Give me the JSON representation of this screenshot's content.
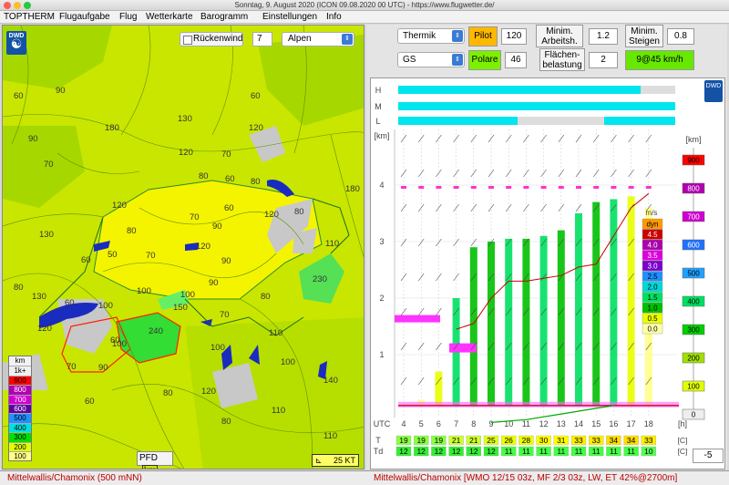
{
  "window": {
    "title": "Sonntag, 9. August 2020 (ICON 09.08.2020 00 UTC) - https://www.flugwetter.de/"
  },
  "menu": [
    "TOPTHERM",
    "Flugaufgabe",
    "Flug",
    "Wetterkarte",
    "Barogramm",
    "Einstellungen",
    "Info"
  ],
  "map": {
    "logo": "DWD",
    "rueckenwind_label": "Rückenwind",
    "stepper_value": "7",
    "region_value": "Alpen",
    "altitude_unit": "km",
    "legend": [
      "1k+",
      "900",
      "800",
      "700",
      "600",
      "500",
      "400",
      "300",
      "200",
      "100"
    ],
    "legend_colors": [
      "#f0f0f0",
      "#ff0000",
      "#b000b0",
      "#d000d0",
      "#6000a0",
      "#2090ff",
      "#00e0e0",
      "#00e000",
      "#e0ff00",
      "#ffff88"
    ],
    "pfd_label": "PFD",
    "pfd_unit": "km",
    "wind_label": "25 KT",
    "labels": [
      {
        "t": "60",
        "x": 12,
        "y": 80
      },
      {
        "t": "90",
        "x": 58,
        "y": 74
      },
      {
        "t": "90",
        "x": 28,
        "y": 127
      },
      {
        "t": "180",
        "x": 112,
        "y": 115
      },
      {
        "t": "70",
        "x": 45,
        "y": 155
      },
      {
        "t": "130",
        "x": 192,
        "y": 105
      },
      {
        "t": "120",
        "x": 270,
        "y": 115
      },
      {
        "t": "60",
        "x": 272,
        "y": 80
      },
      {
        "t": "120",
        "x": 193,
        "y": 142
      },
      {
        "t": "70",
        "x": 240,
        "y": 144
      },
      {
        "t": "60",
        "x": 244,
        "y": 171
      },
      {
        "t": "80",
        "x": 215,
        "y": 168
      },
      {
        "t": "80",
        "x": 272,
        "y": 174
      },
      {
        "t": "180",
        "x": 376,
        "y": 182
      },
      {
        "t": "120",
        "x": 120,
        "y": 200
      },
      {
        "t": "80",
        "x": 136,
        "y": 228
      },
      {
        "t": "70",
        "x": 205,
        "y": 213
      },
      {
        "t": "90",
        "x": 230,
        "y": 223
      },
      {
        "t": "60",
        "x": 243,
        "y": 203
      },
      {
        "t": "120",
        "x": 287,
        "y": 210
      },
      {
        "t": "80",
        "x": 320,
        "y": 207
      },
      {
        "t": "130",
        "x": 40,
        "y": 232
      },
      {
        "t": "60",
        "x": 86,
        "y": 260
      },
      {
        "t": "50",
        "x": 115,
        "y": 254
      },
      {
        "t": "70",
        "x": 157,
        "y": 255
      },
      {
        "t": "120",
        "x": 212,
        "y": 245
      },
      {
        "t": "90",
        "x": 240,
        "y": 261
      },
      {
        "t": "110",
        "x": 354,
        "y": 242
      },
      {
        "t": "130",
        "x": 32,
        "y": 300
      },
      {
        "t": "60",
        "x": 68,
        "y": 307
      },
      {
        "t": "100",
        "x": 147,
        "y": 294
      },
      {
        "t": "100",
        "x": 195,
        "y": 298
      },
      {
        "t": "90",
        "x": 226,
        "y": 285
      },
      {
        "t": "80",
        "x": 283,
        "y": 300
      },
      {
        "t": "230",
        "x": 340,
        "y": 281
      },
      {
        "t": "80",
        "x": 12,
        "y": 290
      },
      {
        "t": "100",
        "x": 105,
        "y": 310
      },
      {
        "t": "150",
        "x": 187,
        "y": 312
      },
      {
        "t": "70",
        "x": 238,
        "y": 320
      },
      {
        "t": "110",
        "x": 292,
        "y": 340
      },
      {
        "t": "120",
        "x": 38,
        "y": 335
      },
      {
        "t": "100",
        "x": 120,
        "y": 352
      },
      {
        "t": "240",
        "x": 160,
        "y": 338
      },
      {
        "t": "100",
        "x": 228,
        "y": 356
      },
      {
        "t": "70",
        "x": 70,
        "y": 377
      },
      {
        "t": "60",
        "x": 118,
        "y": 348
      },
      {
        "t": "90",
        "x": 105,
        "y": 378
      },
      {
        "t": "100",
        "x": 305,
        "y": 372
      },
      {
        "t": "140",
        "x": 352,
        "y": 392
      },
      {
        "t": "80",
        "x": 176,
        "y": 406
      },
      {
        "t": "120",
        "x": 218,
        "y": 404
      },
      {
        "t": "60",
        "x": 90,
        "y": 415
      },
      {
        "t": "110",
        "x": 295,
        "y": 425
      },
      {
        "t": "100",
        "x": 10,
        "y": 437
      },
      {
        "t": "80",
        "x": 240,
        "y": 437
      },
      {
        "t": "110",
        "x": 352,
        "y": 453
      }
    ]
  },
  "panel": {
    "mode_value": "Thermik",
    "pilot_label": "Pilot",
    "pilot_value": "120",
    "min_arbeitsh_label": "Minim. Arbeitsh.",
    "min_arbeitsh_value": "1.2",
    "min_steigen_label": "Minim. Steigen",
    "min_steigen_value": "0.8",
    "glider_value": "GS",
    "polare_label": "Polare",
    "polare_value": "46",
    "flaechen_label": "Flächen- belastung",
    "flaechen_value": "2",
    "speed_result": "9@45 km/h"
  },
  "meteogram": {
    "logo": "DWD",
    "cloud_rows": [
      "H",
      "M",
      "L"
    ],
    "y_unit": "[km]",
    "y_ticks": [
      "4",
      "3",
      "2",
      "1"
    ],
    "x_label": "UTC",
    "x_unit": "[h]",
    "hours": [
      "4",
      "5",
      "6",
      "7",
      "8",
      "9",
      "10",
      "11",
      "12",
      "13",
      "14",
      "15",
      "16",
      "17",
      "18"
    ],
    "inner_legend_unit": "m/s",
    "inner_legend": [
      "dyn",
      "4.5",
      "4.0",
      "3.5",
      "3.0",
      "2.5",
      "2.0",
      "1.5",
      "1.0",
      "0.5",
      "0.0"
    ],
    "inner_legend_colors": [
      "#ff9900",
      "#cc0000",
      "#aa00aa",
      "#dd00dd",
      "#7b00cc",
      "#1e90ff",
      "#00d8d8",
      "#00e060",
      "#00c000",
      "#e8ff00",
      "#ffffaa"
    ],
    "right_scale_unit": "[km]",
    "right_scale": [
      "900",
      "800",
      "700",
      "600",
      "500",
      "400",
      "300",
      "200",
      "100",
      "0"
    ],
    "right_scale_colors": [
      "#ff0000",
      "#b000b0",
      "#d000d0",
      "#2070ff",
      "#20a0ff",
      "#00e060",
      "#00d000",
      "#a0e000",
      "#e0ff00",
      "#eeeeee"
    ],
    "t_label": "T",
    "td_label": "Td",
    "t_unit": "[C]",
    "td_unit": "[C]",
    "t_values": [
      "19",
      "19",
      "19",
      "21",
      "21",
      "25",
      "26",
      "28",
      "30",
      "31",
      "33",
      "33",
      "34",
      "34",
      "33"
    ],
    "td_values": [
      "12",
      "12",
      "12",
      "12",
      "12",
      "12",
      "11",
      "11",
      "11",
      "11",
      "11",
      "11",
      "11",
      "11",
      "10"
    ],
    "t_colors": [
      "#88ff44",
      "#88ff44",
      "#88ff44",
      "#ccff33",
      "#ccff33",
      "#ddff22",
      "#eeff00",
      "#eeff00",
      "#ffff00",
      "#ffff00",
      "#ffee00",
      "#ffee00",
      "#ffdd00",
      "#ffdd00",
      "#ffee00"
    ],
    "td_colors": [
      "#33ee33",
      "#33ee33",
      "#33ee33",
      "#33ee33",
      "#33ee33",
      "#33ee33",
      "#44ff44",
      "#44ff44",
      "#44ff44",
      "#44ff44",
      "#44ff44",
      "#44ff44",
      "#44ff44",
      "#44ff44",
      "#55ff55"
    ],
    "offset_value": "-5"
  },
  "status": {
    "left": "Mittelwallis/Chamonix (500 mNN)",
    "right": "Mittelwallis/Chamonix [WMO 12/15 03z, MF 2/3 03z, LW, ET  42%@2700m]"
  }
}
